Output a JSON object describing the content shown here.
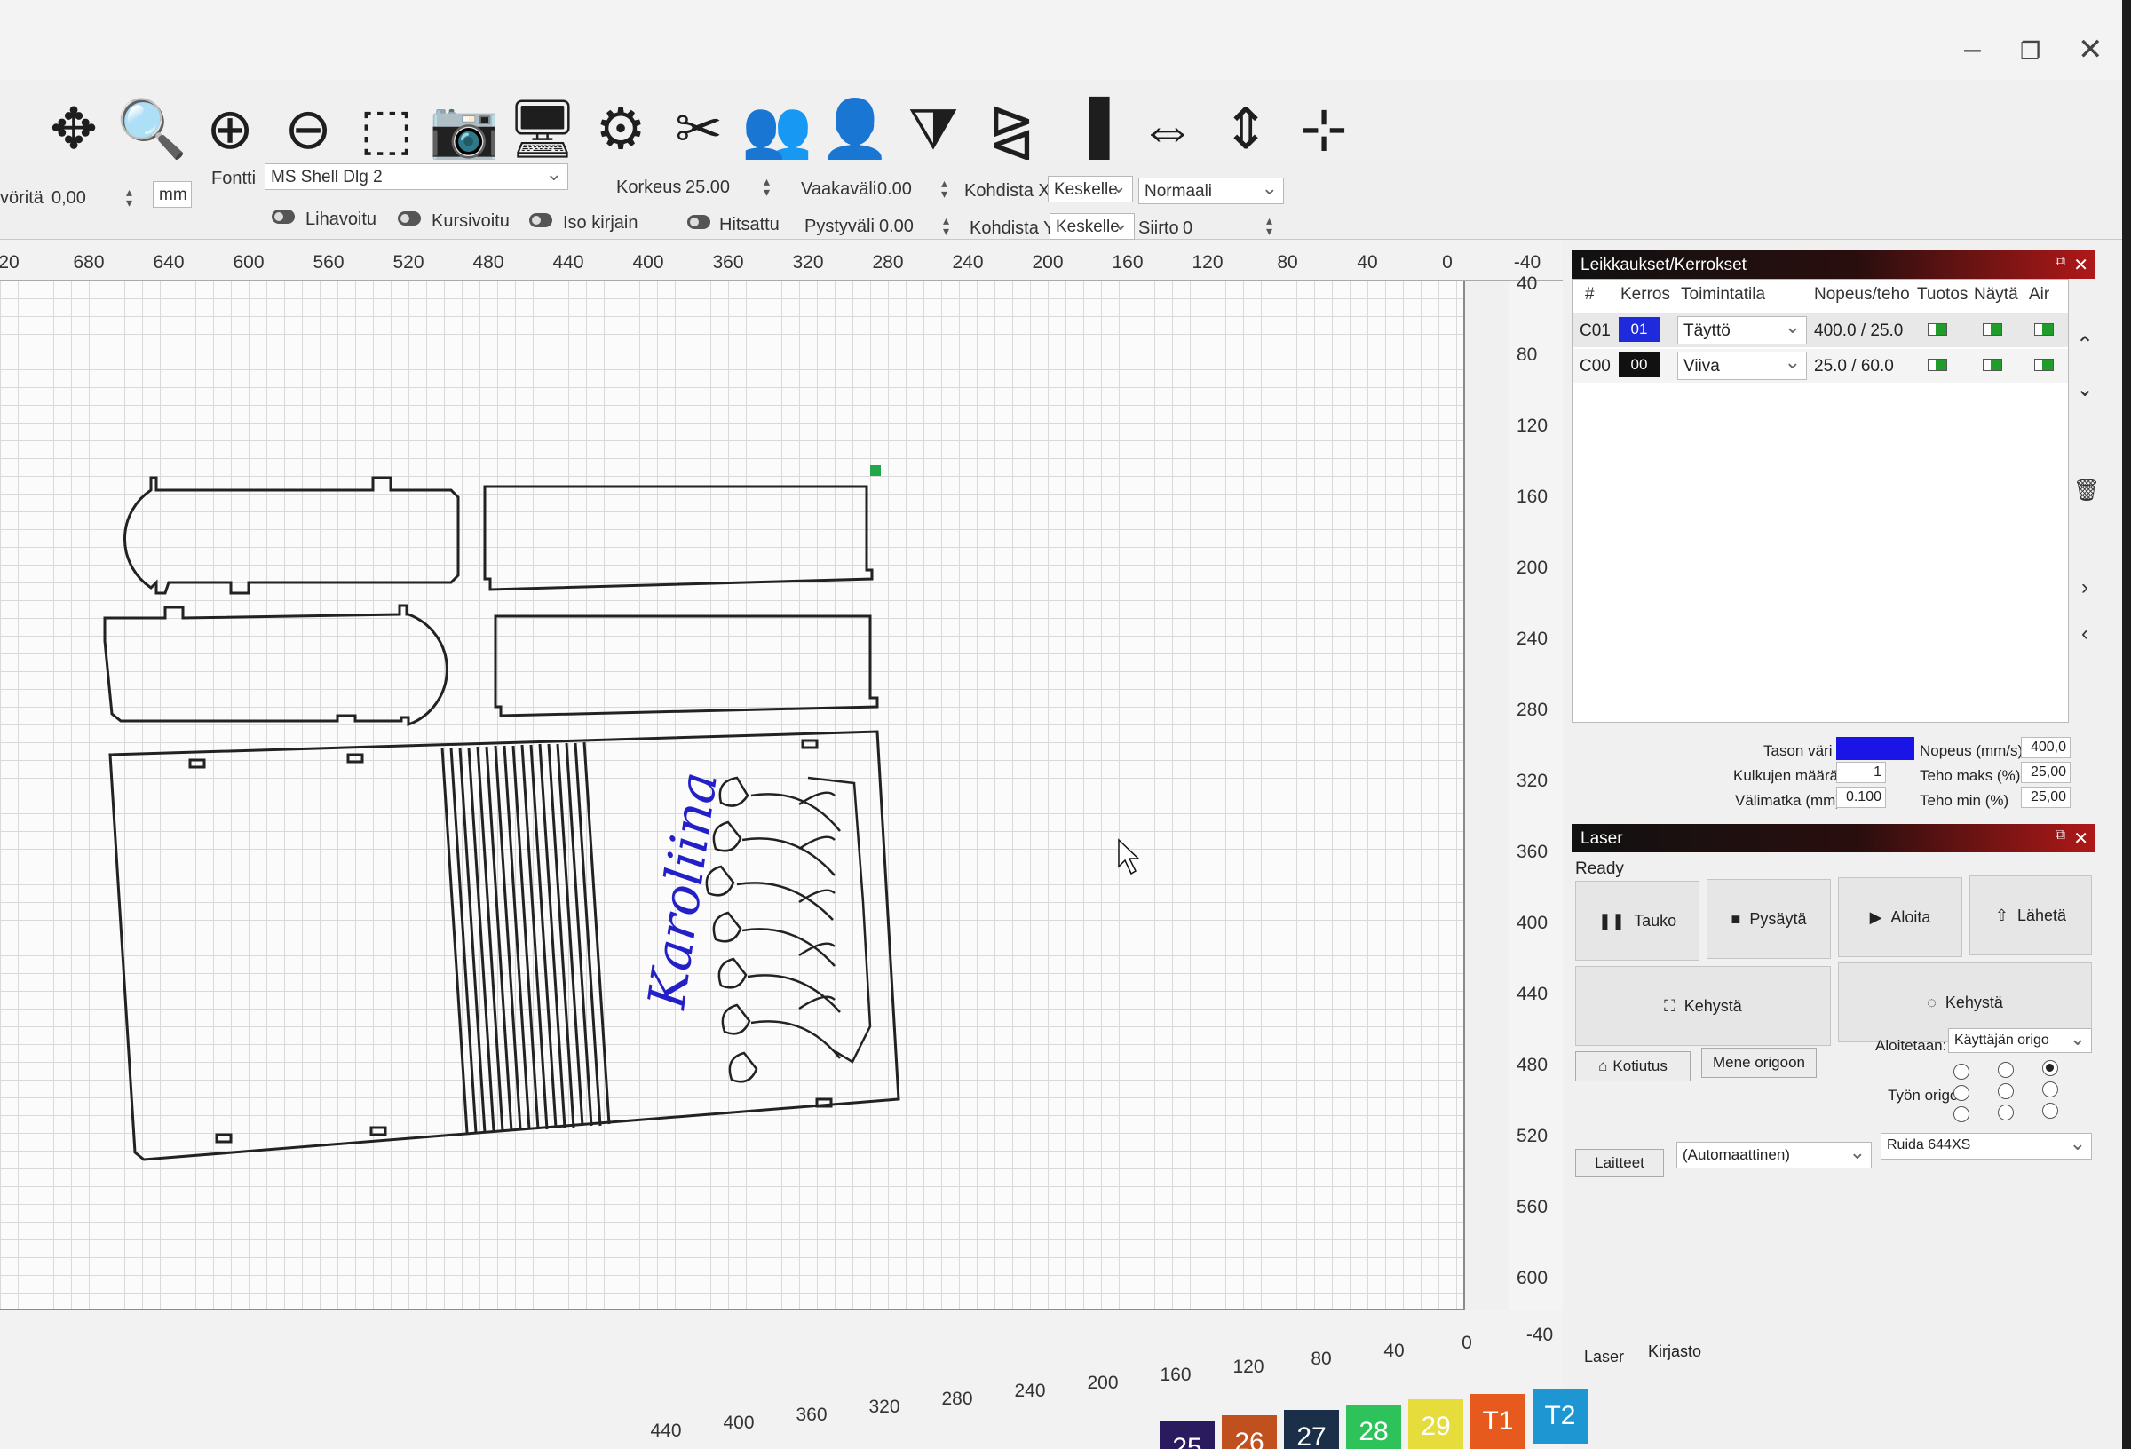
{
  "toolbar": {
    "tools": [
      {
        "icon": "move-icon",
        "glyph": "✥"
      },
      {
        "icon": "zoom-page-icon",
        "glyph": "🔍"
      },
      {
        "icon": "zoom-in-icon",
        "glyph": "⊕"
      },
      {
        "icon": "zoom-out-icon",
        "glyph": "⊖"
      },
      {
        "icon": "select-frame-icon",
        "glyph": "⬚"
      },
      {
        "icon": "camera-icon",
        "glyph": "📷"
      },
      {
        "icon": "monitor-icon",
        "glyph": "🖥"
      },
      {
        "icon": "settings-gears-icon",
        "glyph": "⚙"
      },
      {
        "icon": "tools-icon",
        "glyph": "✂"
      },
      {
        "icon": "users-icon",
        "glyph": "👥"
      },
      {
        "icon": "user-icon",
        "glyph": "👤"
      },
      {
        "icon": "mirror-icon",
        "glyph": "⧩"
      },
      {
        "icon": "flip-icon",
        "glyph": "⧎"
      },
      {
        "icon": "align-left-icon",
        "glyph": "▐"
      },
      {
        "icon": "distribute-h-icon",
        "glyph": "⇔"
      },
      {
        "icon": "distribute-v-icon",
        "glyph": "⇕"
      },
      {
        "icon": "origin-icon",
        "glyph": "⊹"
      }
    ]
  },
  "props": {
    "fill_label": "vöritä",
    "fill_value": "0,00",
    "unit": "mm",
    "font_label": "Fontti",
    "font_value": "MS Shell Dlg 2",
    "height_label": "Korkeus",
    "height_value": "25.00",
    "hspace_label": "Vaakaväli",
    "hspace_value": "0.00",
    "vspace_label": "Pystyväli",
    "vspace_value": "0.00",
    "alignx_label": "Kohdista X",
    "alignx_value": "Keskelle",
    "aligny_label": "Kohdista Y",
    "aligny_value": "Keskelle",
    "style_value": "Normaali",
    "offset_label": "Siirto",
    "offset_value": "0",
    "bold_label": "Lihavoitu",
    "italic_label": "Kursivoitu",
    "caps_label": "Iso kirjain",
    "weld_label": "Hitsattu"
  },
  "rulers": {
    "top": [
      "20",
      "680",
      "640",
      "600",
      "560",
      "520",
      "480",
      "440",
      "400",
      "360",
      "320",
      "280",
      "240",
      "200",
      "160",
      "120",
      "80",
      "40",
      "0",
      "-40"
    ],
    "right": [
      "40",
      "80",
      "120",
      "160",
      "200",
      "240",
      "280",
      "320",
      "360",
      "400",
      "440",
      "480",
      "520",
      "560",
      "600",
      "-40"
    ],
    "bottom": [
      "440",
      "400",
      "360",
      "320",
      "280",
      "240",
      "200",
      "160",
      "120",
      "80",
      "40",
      "0",
      "-40"
    ]
  },
  "canvas": {
    "text": "Karoliina"
  },
  "palette": [
    {
      "label": "25",
      "color": "#2a1a5e"
    },
    {
      "label": "26",
      "color": "#c0501e"
    },
    {
      "label": "27",
      "color": "#1c2f48"
    },
    {
      "label": "28",
      "color": "#2ec25a"
    },
    {
      "label": "29",
      "color": "#e6dc3c"
    },
    {
      "label": "T1",
      "color": "#e65a1e"
    },
    {
      "label": "T2",
      "color": "#1e96d2"
    }
  ],
  "layers_panel": {
    "title": "Leikkaukset/Kerrokset",
    "headers": [
      "#",
      "Kerros",
      "Toimintatila",
      "Nopeus/teho",
      "Tuotos",
      "Näytä",
      "Air"
    ],
    "rows": [
      {
        "id": "C01",
        "layer": "01",
        "color": "#1e2adc",
        "mode": "Täyttö",
        "speed_power": "400.0 / 25.0"
      },
      {
        "id": "C00",
        "layer": "00",
        "color": "#111111",
        "mode": "Viiva",
        "speed_power": "25.0 / 60.0"
      }
    ],
    "settings": {
      "color_label": "Tason väri",
      "layer_color": "#1a14e6",
      "speed_label": "Nopeus (mm/s)",
      "speed_value": "400,0",
      "passes_label": "Kulkujen määrä",
      "passes_value": "1",
      "maxpower_label": "Teho maks (%)",
      "maxpower_value": "25,00",
      "interval_label": "Välimatka (mm)",
      "interval_value": "0.100",
      "minpower_label": "Teho min (%)",
      "minpower_value": "25,00"
    }
  },
  "laser_panel": {
    "title": "Laser",
    "status": "Ready",
    "pause": "Tauko",
    "stop": "Pysäytä",
    "start": "Aloita",
    "send": "Lähetä",
    "frame1": "Kehystä",
    "frame2": "Kehystä",
    "home": "Kotiutus",
    "go_origin": "Mene origoon",
    "start_from_label": "Aloitetaan:",
    "start_from_value": "Käyttäjän origo",
    "job_origin_label": "Työn origo",
    "devices": "Laitteet",
    "port_value": "(Automaattinen)",
    "device_value": "Ruida 644XS"
  },
  "tabs": {
    "laser": "Laser",
    "library": "Kirjasto"
  }
}
